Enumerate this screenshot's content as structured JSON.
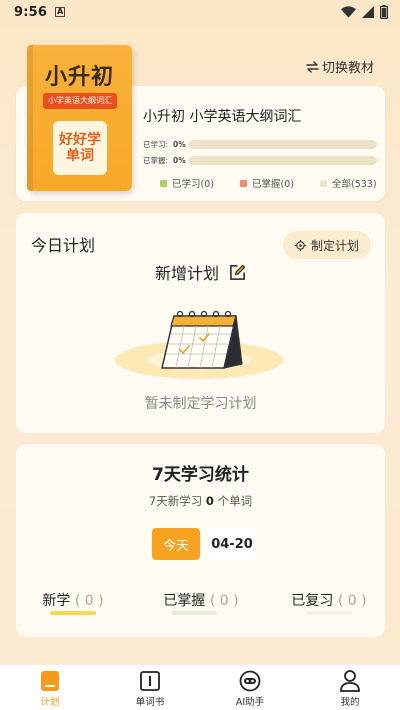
{
  "status_bar": {
    "time": "9:56",
    "notif_icon": "A"
  },
  "header": {
    "switch_label": "切换教材"
  },
  "book": {
    "cover_title": "小升初",
    "cover_tag": "小学英语大纲词汇",
    "cover_badge_line1": "好好学",
    "cover_badge_line2": "单词",
    "name": "小升初 小学英语大纲词汇",
    "learned_label": "已学习:",
    "learned_pct": "0%",
    "learned_progress": 0,
    "mastered_label": "已掌握:",
    "mastered_pct": "0%",
    "mastered_progress": 0,
    "legend": [
      {
        "label": "已学习(0)",
        "color": "#a9cf6b"
      },
      {
        "label": "已掌握(0)",
        "color": "#ee8a70"
      },
      {
        "label": "全部(533)",
        "color": "#ece6c7"
      }
    ]
  },
  "plan": {
    "title": "今日计划",
    "set_plan_label": "制定计划",
    "new_plan_label": "新增计划",
    "empty_text": "暂未制定学习计划"
  },
  "stats": {
    "title": "7天学习统计",
    "sub_prefix": "7天新学习",
    "sub_count": "0",
    "sub_suffix": "个单词",
    "today_label": "今天",
    "date": "04-20",
    "items": [
      {
        "label": "新学",
        "value": "( 0 )",
        "color": "#f6d84a"
      },
      {
        "label": "已掌握",
        "value": "( 0 )",
        "color": "#e6ecd8"
      },
      {
        "label": "已复习",
        "value": "( 0 )",
        "color": "#f2f2ee"
      }
    ]
  },
  "nav": {
    "items": [
      {
        "label": "计划",
        "icon": "plan-icon",
        "active": true
      },
      {
        "label": "单词书",
        "icon": "wordbook-icon",
        "active": false
      },
      {
        "label": "AI助手",
        "icon": "ai-assistant-icon",
        "active": false
      },
      {
        "label": "我的",
        "icon": "profile-icon",
        "active": false
      }
    ]
  }
}
